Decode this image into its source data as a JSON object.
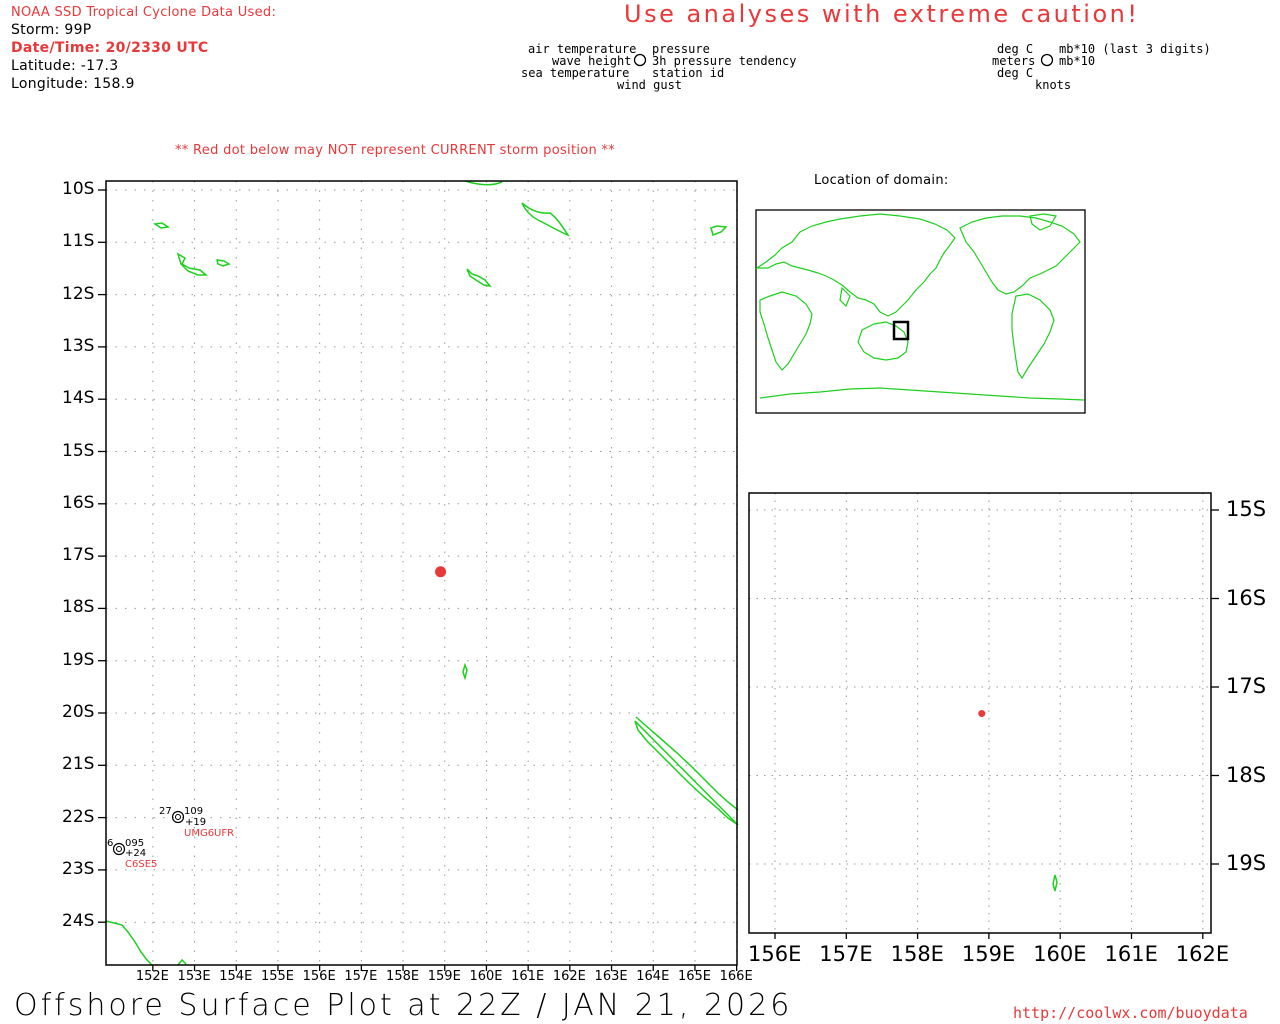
{
  "header": {
    "source": "NOAA SSD Tropical Cyclone Data Used:",
    "storm": "Storm: 99P",
    "datetime": "Date/Time: 20/2330 UTC",
    "latitude": "Latitude: -17.3",
    "longitude": "Longitude: 158.9",
    "caution": "Use analyses with extreme caution!",
    "red_dot_note": "** Red dot below may NOT represent CURRENT storm position **"
  },
  "legend_station": {
    "air_temperature": "air temperature",
    "wave_height": "wave height",
    "sea_temperature": "sea temperature",
    "wind_gust": "wind gust",
    "pressure": "pressure",
    "pressure_tendency": "3h pressure tendency",
    "station_id": "station id"
  },
  "legend_units": {
    "deg_c_1": "deg C",
    "meters": "meters",
    "deg_c_2": "deg C",
    "mb10_last3": "mb*10 (last 3 digits)",
    "mb10": "mb*10",
    "knots": "knots"
  },
  "inset": {
    "title": "Location of domain:"
  },
  "main_map": {
    "lat_labels": [
      "10S",
      "11S",
      "12S",
      "13S",
      "14S",
      "15S",
      "16S",
      "17S",
      "18S",
      "19S",
      "20S",
      "21S",
      "22S",
      "23S",
      "24S"
    ],
    "lon_labels": [
      "152E",
      "153E",
      "154E",
      "155E",
      "156E",
      "157E",
      "158E",
      "159E",
      "160E",
      "161E",
      "162E",
      "163E",
      "164E",
      "165E",
      "166E"
    ],
    "storm_position": {
      "lat": -17.3,
      "lon": 158.9
    },
    "stations": [
      {
        "id": "UMG6UFR",
        "air_temp": "27",
        "pressure": "109",
        "tendency": "+19"
      },
      {
        "id": "C6SE5",
        "air_temp": "6",
        "pressure": "095",
        "tendency": "+24"
      }
    ]
  },
  "zoom_map": {
    "lat_labels": [
      "15S",
      "16S",
      "17S",
      "18S",
      "19S"
    ],
    "lon_labels": [
      "156E",
      "157E",
      "158E",
      "159E",
      "160E",
      "161E",
      "162E"
    ]
  },
  "footer": {
    "title": "Offshore Surface Plot at 22Z / JAN 21, 2026",
    "url": "http://coolwx.com/buoydata"
  },
  "colors": {
    "accent_red": "#e8383a",
    "coastline": "#1ed01e",
    "grid": "#9a9a9a"
  }
}
